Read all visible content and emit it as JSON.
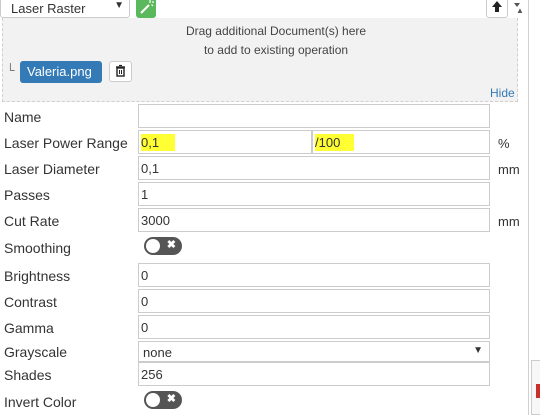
{
  "operation": {
    "type_label": "Laser Raster"
  },
  "drop_zone": {
    "line1": "Drag additional Document(s) here",
    "line2": "to add to existing operation",
    "document_name": "Valeria.png",
    "hide_link": "Hide"
  },
  "form": {
    "name": {
      "label": "Name",
      "value": ""
    },
    "laser_power_range": {
      "label": "Laser Power Range",
      "min": "0,1",
      "max": "/100",
      "unit": "%"
    },
    "laser_diameter": {
      "label": "Laser Diameter",
      "value": "0,1",
      "unit": "mm"
    },
    "passes": {
      "label": "Passes",
      "value": "1"
    },
    "cut_rate": {
      "label": "Cut Rate",
      "value": "3000",
      "unit": "mm"
    },
    "smoothing": {
      "label": "Smoothing",
      "enabled": false
    },
    "brightness": {
      "label": "Brightness",
      "value": "0"
    },
    "contrast": {
      "label": "Contrast",
      "value": "0"
    },
    "gamma": {
      "label": "Gamma",
      "value": "0"
    },
    "grayscale": {
      "label": "Grayscale",
      "selected": "none"
    },
    "shades": {
      "label": "Shades",
      "value": "256"
    },
    "invert_color": {
      "label": "Invert Color",
      "enabled": false
    }
  },
  "icons": {
    "wand": "magic-wand-icon",
    "up": "arrow-up-icon",
    "trash": "trash-icon",
    "dropdown": "caret-down-icon"
  },
  "colors": {
    "primary": "#337ab7",
    "success": "#5cb85c",
    "highlight": "#ffff33",
    "toggle_off": "#555555"
  }
}
